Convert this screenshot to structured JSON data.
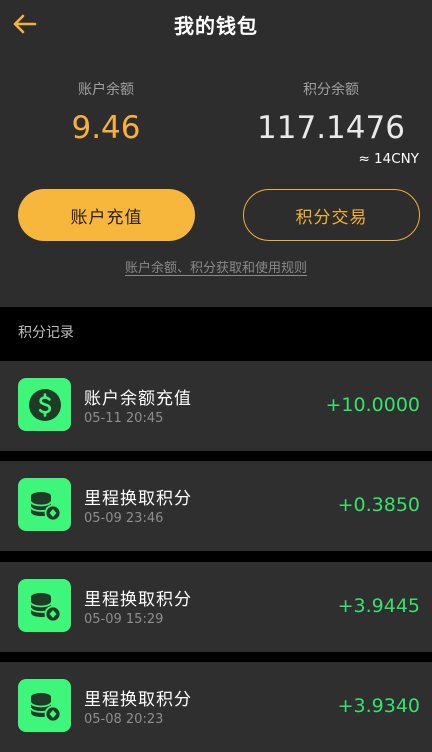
{
  "header": {
    "title": "我的钱包",
    "back_icon": "arrow-left-icon",
    "accent_color": "#f6b13c"
  },
  "balances": {
    "account_label": "账户余额",
    "account_value": "9.46",
    "points_label": "积分余额",
    "points_value": "117.1476",
    "points_cny": "≈ 14CNY"
  },
  "actions": {
    "recharge_label": "账户充值",
    "trade_label": "积分交易",
    "rules_link": "账户余额、积分获取和使用规则"
  },
  "records": {
    "section_label": "积分记录",
    "items": [
      {
        "icon": "dollar-coin-icon",
        "title": "账户余额充值",
        "time": "05-11 20:45",
        "amount": "+10.0000"
      },
      {
        "icon": "coin-stack-icon",
        "title": "里程换取积分",
        "time": "05-09 23:46",
        "amount": "+0.3850"
      },
      {
        "icon": "coin-stack-icon",
        "title": "里程换取积分",
        "time": "05-09 15:29",
        "amount": "+3.9445"
      },
      {
        "icon": "coin-stack-icon",
        "title": "里程换取积分",
        "time": "05-08 20:23",
        "amount": "+3.9340"
      }
    ]
  },
  "colors": {
    "panel": "#2d2d2d",
    "positive": "#35e36b",
    "icon_bg": "#3ef77a"
  }
}
